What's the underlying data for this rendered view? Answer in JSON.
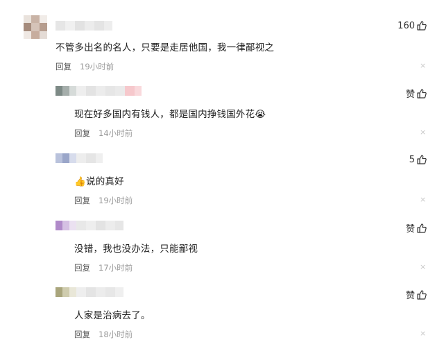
{
  "comments": [
    {
      "text": "不管多出名的名人，只要是走居他国，我一律鄙视之",
      "reply_label": "回复",
      "time": "19小时前",
      "likes": "160",
      "close": "×"
    },
    {
      "text": "现在好多国内有钱人，都是国内挣钱国外花😭",
      "reply_label": "回复",
      "time": "14小时前",
      "likes": "赞",
      "close": "×"
    },
    {
      "text": "👍说的真好",
      "reply_label": "回复",
      "time": "19小时前",
      "likes": "5",
      "close": "×"
    },
    {
      "text": "没错，我也没办法，只能鄙视",
      "reply_label": "回复",
      "time": "17小时前",
      "likes": "赞",
      "close": "×"
    },
    {
      "text": "人家是治病去了。",
      "reply_label": "回复",
      "time": "18小时前",
      "likes": "赞",
      "close": "×"
    }
  ],
  "colors": {
    "meta": "#999999",
    "reply": "#555555",
    "close": "#c8c8c8"
  },
  "icons": {
    "like": "thumbs-up-outline-icon",
    "close": "close-icon"
  }
}
